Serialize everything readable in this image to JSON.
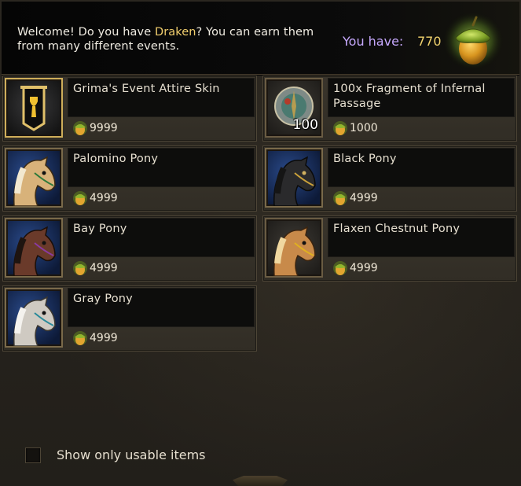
{
  "header": {
    "welcome_pre": "Welcome! Do you have ",
    "welcome_highlight": "Draken",
    "welcome_post": "? You can earn them from many different events.",
    "you_have_label": "You have:",
    "you_have_value": "770",
    "currency_icon": "acorn-icon"
  },
  "items": [
    {
      "name": "Grima's Event Attire Skin",
      "price": "9999",
      "icon": "shield-banner-icon",
      "quantity": ""
    },
    {
      "name": "100x Fragment of Infernal Passage",
      "price": "1000",
      "icon": "coin-fragment-icon",
      "quantity": "100"
    },
    {
      "name": "Palomino Pony",
      "price": "4999",
      "icon": "pony-icon",
      "quantity": ""
    },
    {
      "name": "Black Pony",
      "price": "4999",
      "icon": "pony-icon",
      "quantity": ""
    },
    {
      "name": "Bay Pony",
      "price": "4999",
      "icon": "pony-icon",
      "quantity": ""
    },
    {
      "name": "Flaxen Chestnut Pony",
      "price": "4999",
      "icon": "pony-icon",
      "quantity": ""
    },
    {
      "name": "Gray Pony",
      "price": "4999",
      "icon": "pony-icon",
      "quantity": ""
    }
  ],
  "filter": {
    "label": "Show only usable items",
    "checked": false
  },
  "colors": {
    "highlight": "#f2cf6e",
    "you_have_label": "#c7a9ff",
    "panel": "#26231d"
  }
}
